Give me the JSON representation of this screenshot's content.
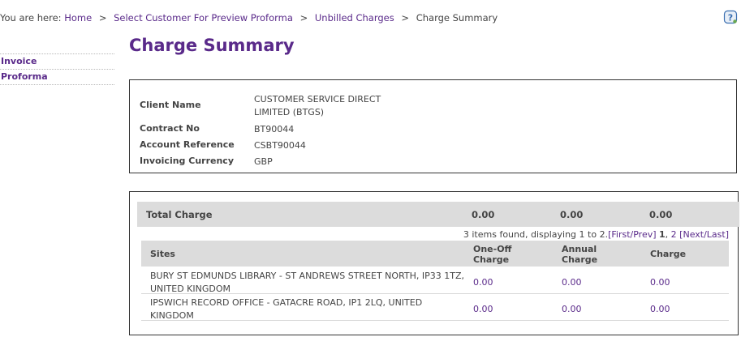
{
  "breadcrumb": {
    "prefix": "You are here:",
    "items": [
      {
        "label": "Home",
        "link": true
      },
      {
        "label": "Select Customer For Preview Proforma",
        "link": true
      },
      {
        "label": "Unbilled Charges",
        "link": true
      },
      {
        "label": "Charge Summary",
        "link": false
      }
    ],
    "separator": ">"
  },
  "help_icon": "help-question-icon",
  "sidebar": {
    "items": [
      {
        "label": "Invoice"
      },
      {
        "label": "Proforma"
      }
    ]
  },
  "page_title": "Charge Summary",
  "details": {
    "client_name_label": "Client Name",
    "client_name_value": "CUSTOMER SERVICE DIRECT LIMITED (BTGS)",
    "contract_no_label": "Contract No",
    "contract_no_value": "BT90044",
    "account_ref_label": "Account Reference",
    "account_ref_value": "CSBT90044",
    "currency_label": "Invoicing Currency",
    "currency_value": "GBP"
  },
  "total": {
    "label": "Total Charge",
    "one_off": "0.00",
    "annual": "0.00",
    "charge": "0.00"
  },
  "pager": {
    "summary": "3 items found, displaying 1 to 2.",
    "first_prev": "[First/Prev]",
    "current_page": "1",
    "comma": ",",
    "page2": "2",
    "next_last": "[Next/Last]"
  },
  "table": {
    "headers": {
      "sites": "Sites",
      "one_off": "One-Off Charge",
      "annual": "Annual Charge",
      "charge": "Charge"
    },
    "rows": [
      {
        "site": "BURY ST EDMUNDS LIBRARY - ST ANDREWS STREET NORTH, IP33 1TZ, UNITED KINGDOM",
        "one_off": "0.00",
        "annual": "0.00",
        "charge": "0.00"
      },
      {
        "site": "IPSWICH RECORD OFFICE - GATACRE ROAD, IP1 2LQ, UNITED KINGDOM",
        "one_off": "0.00",
        "annual": "0.00",
        "charge": "0.00"
      }
    ]
  },
  "colors": {
    "accent": "#5a2a8a",
    "header_bg": "#dcdcdc"
  }
}
